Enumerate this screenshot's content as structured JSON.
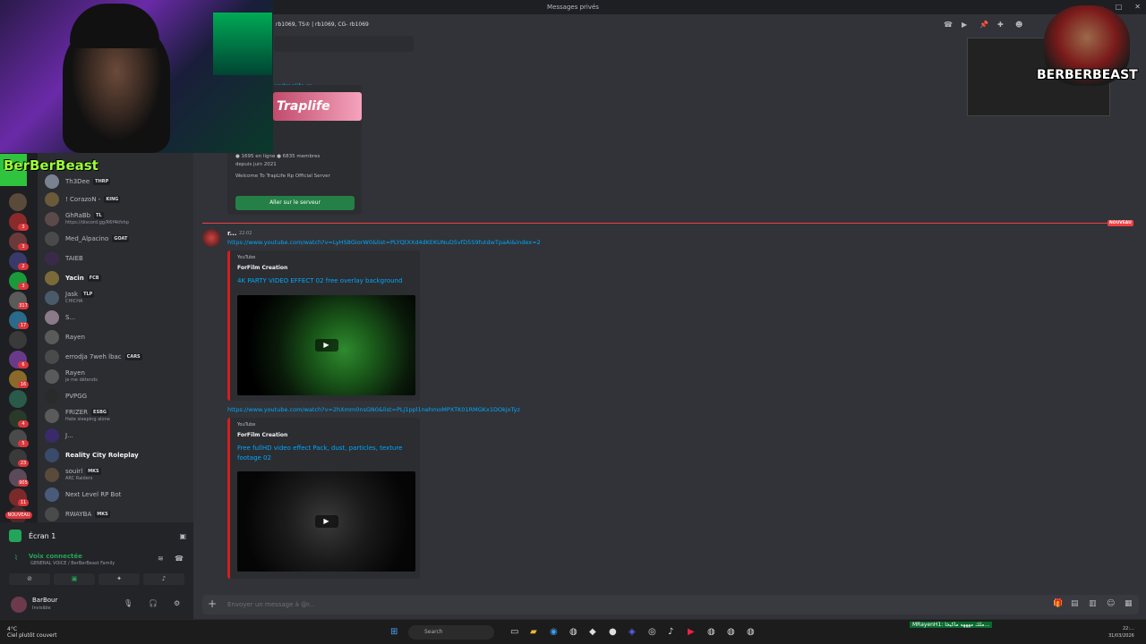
{
  "window": {
    "title": "Messages privés"
  },
  "header": {
    "group_members": "rb1069, TS♔ | rb1069, CG- rb1069"
  },
  "overlay": {
    "stream_name": "BerBerBeast",
    "logo_text": "BERBERBEAST"
  },
  "rail_badges": [
    "3",
    "3",
    "2",
    "3",
    "317",
    "17",
    "6",
    "16",
    "4",
    "5",
    "23",
    "905",
    "11",
    "NOUVEAU"
  ],
  "dms": [
    {
      "name": "Th3Dee",
      "tag": "THRP",
      "sub": "",
      "bold": false,
      "color": "#7a8290"
    },
    {
      "name": "! CorazoN -",
      "tag": "KING",
      "sub": "",
      "bold": false,
      "color": "#6b5a3a"
    },
    {
      "name": "GhRaBb",
      "tag": "TL",
      "sub": "https://discord.gg/R6f4kfshp",
      "bold": false,
      "color": "#5a4a4a"
    },
    {
      "name": "Med_Alpacino",
      "tag": "GOAT",
      "sub": "",
      "bold": false,
      "color": "#4a4a4a"
    },
    {
      "name": "TAIEB",
      "tag": "",
      "sub": "",
      "bold": false,
      "color": "#3a2a4a"
    },
    {
      "name": "Yacin",
      "tag": "FCB",
      "sub": "",
      "bold": true,
      "color": "#7a6a3a"
    },
    {
      "name": "Jask",
      "tag": "TLP",
      "sub": "CHICHA",
      "bold": false,
      "color": "#4a5a6a"
    },
    {
      "name": "S...",
      "tag": "",
      "sub": "",
      "bold": false,
      "color": "#8a7a8a"
    },
    {
      "name": "Rayen",
      "tag": "",
      "sub": "",
      "bold": false,
      "color": "#5a5a5a"
    },
    {
      "name": "errodja 7weh lbac",
      "tag": "CARS",
      "sub": "",
      "bold": false,
      "color": "#4a4a4a"
    },
    {
      "name": "Rayen",
      "tag": "",
      "sub": "je me détends",
      "bold": false,
      "color": "#5a5a5a"
    },
    {
      "name": "PVPGG",
      "tag": "",
      "sub": "",
      "bold": false,
      "color": "#2a2a2a"
    },
    {
      "name": "FRIZER",
      "tag": "ESBG",
      "sub": "Hate sleeping alone",
      "bold": false,
      "color": "#5a5a5a"
    },
    {
      "name": "J...",
      "tag": "",
      "sub": "",
      "bold": false,
      "color": "#3a2a6a"
    },
    {
      "name": "Reality City Roleplay",
      "tag": "",
      "sub": "",
      "bold": true,
      "color": "#3a4a6a"
    },
    {
      "name": "souirl",
      "tag": "MKS",
      "sub": "ARC Raiders",
      "bold": false,
      "color": "#5a4a3a"
    },
    {
      "name": "Next Level RP Bot",
      "tag": "",
      "sub": "",
      "bold": false,
      "color": "#4a5a7a"
    },
    {
      "name": "RWAYBA",
      "tag": "MKS",
      "sub": "",
      "bold": false,
      "color": "#4a4a4a"
    }
  ],
  "voice": {
    "screen_label": "Écran 1",
    "status": "Voix connectée",
    "channel": "GENERAL VOICE / BerBerBeast Family"
  },
  "user": {
    "name": "BarBour",
    "status": "Invisible"
  },
  "invite": {
    "link": "gg/traplife-rp",
    "banner": "Traplife",
    "online": "1695 en ligne",
    "members": "6835 membres",
    "since": "depuis juin 2021",
    "desc": "Welcome To TrapLife Rp Official Server",
    "button": "Aller sur le serveur"
  },
  "divider_label": "NOUVEAU",
  "message": {
    "author": "r...",
    "time": "22:02",
    "link1": "https://www.youtube.com/watch?v=LyHS8GiorW0&list=PLYQtXXd4dKEKUNuD5vfD5S9futdwTpaAi&index=2",
    "embed1": {
      "provider": "YouTube",
      "author": "ForFilm Creation",
      "title": "4K PARTY VIDEO EFFECT 02 free overlay background"
    },
    "link2": "https://www.youtube.com/watch?v=2hXmm0nsGN0&list=PLj1ppl1nehmoMPXTK01RMGKx1DOkjoTyz",
    "embed2": {
      "provider": "YouTube",
      "author": "ForFilm Creation",
      "title": "Free fullHD video effect Pack, dust, particles, texture footage 02"
    }
  },
  "composer": {
    "placeholder": "Envoyer un message à @r..."
  },
  "taskbar": {
    "weather_temp": "4°C",
    "weather_desc": "Ciel plutôt couvert",
    "search": "Search",
    "stream_label": "MRayenH1: ملك مهههه ماكيخا...",
    "clock_time": "22:...",
    "clock_date": "31/03/2026"
  }
}
